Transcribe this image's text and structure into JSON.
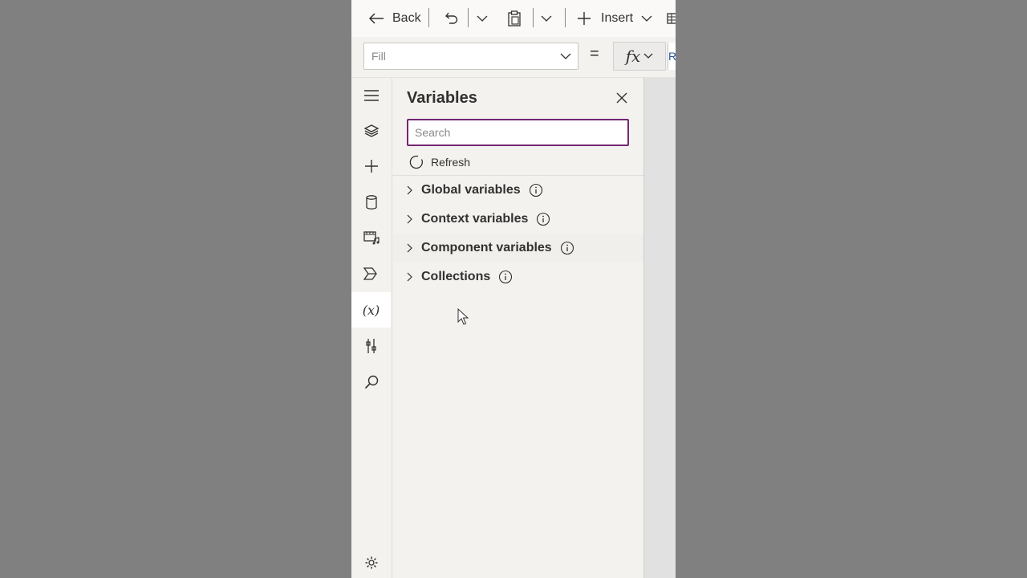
{
  "toolbar": {
    "back_label": "Back",
    "insert_label": "Insert",
    "icons": [
      "back-arrow-icon",
      "undo-icon",
      "chevron-down-icon",
      "paste-icon",
      "chevron-down-icon",
      "add-icon",
      "chevron-down-icon",
      "table-icon"
    ]
  },
  "formula_bar": {
    "property": "Fill",
    "equals": "=",
    "fx_label": "fx",
    "formula_value": "R"
  },
  "rail": {
    "items": [
      "menu-icon",
      "tree-view-icon",
      "insert-icon",
      "data-icon",
      "media-icon",
      "power-automate-icon",
      "variables-icon",
      "advanced-tools-icon",
      "search-icon",
      "settings-icon"
    ],
    "active": "variables-icon"
  },
  "variables_panel": {
    "title": "Variables",
    "search_placeholder": "Search",
    "refresh_label": "Refresh",
    "sections": [
      {
        "label": "Global variables"
      },
      {
        "label": "Context variables"
      },
      {
        "label": "Component variables"
      },
      {
        "label": "Collections"
      }
    ]
  },
  "colors": {
    "accent": "#742774",
    "background": "#808080",
    "panel": "#f3f2ef"
  }
}
